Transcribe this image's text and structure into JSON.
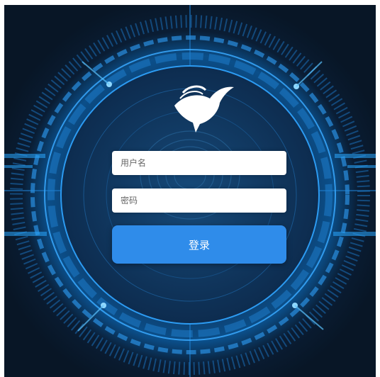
{
  "login_form": {
    "username_placeholder": "用户名",
    "password_placeholder": "密码",
    "submit_label": "登录"
  },
  "theme": {
    "background": "#0a1d34",
    "glow": "#2aa8ff",
    "button": "#2f8cea"
  },
  "icons": {
    "logo": "bird-logo-icon",
    "background_decoration": "fingerprint-icon"
  }
}
